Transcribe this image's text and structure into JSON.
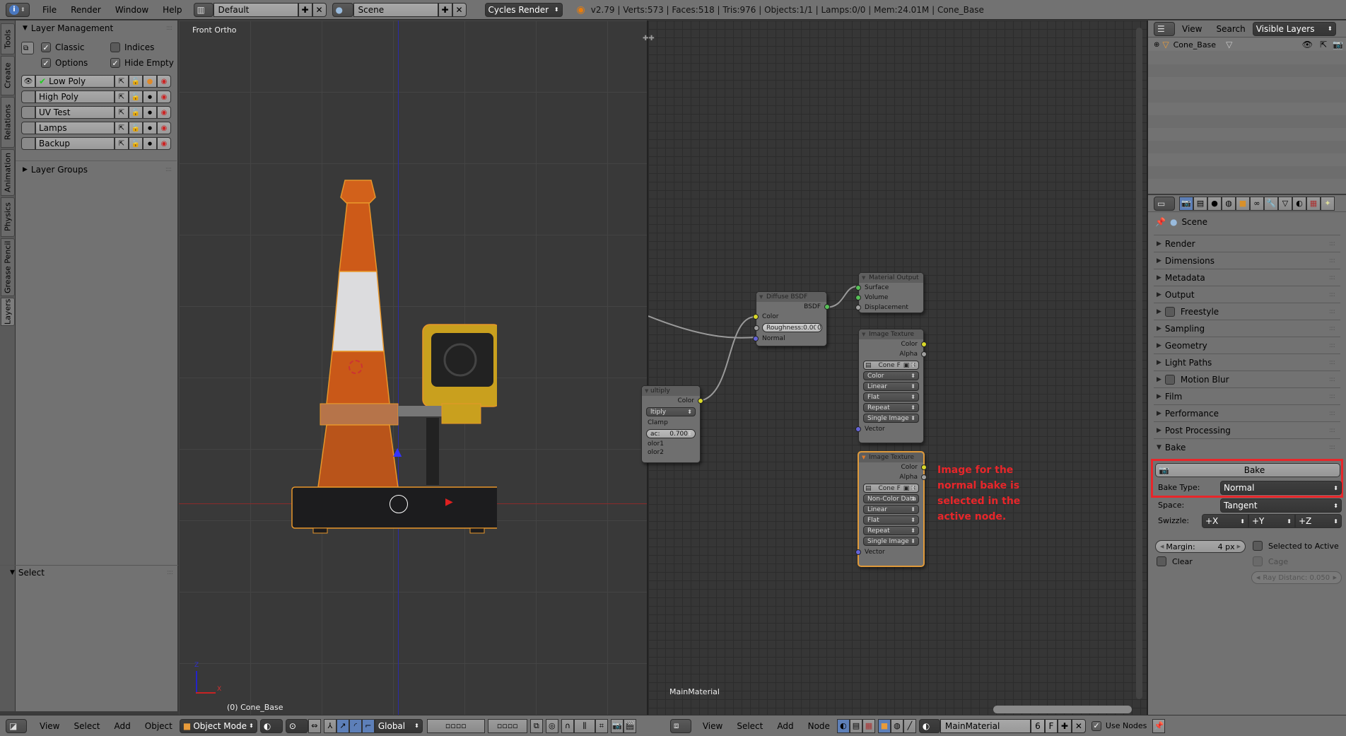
{
  "topbar": {
    "info_icon": "info-icon",
    "menus": [
      "File",
      "Render",
      "Window",
      "Help"
    ],
    "screen_layout": "Default",
    "scene": "Scene",
    "render_engine": "Cycles Render",
    "stats": "v2.79 | Verts:573 | Faces:518 | Tris:976 | Objects:1/1 | Lamps:0/0 | Mem:24.01M | Cone_Base"
  },
  "left_tabs": [
    "Tools",
    "Create",
    "Relations",
    "Animation",
    "Physics",
    "Grease Pencil",
    "Layers"
  ],
  "layer_management": {
    "title": "Layer Management",
    "options": {
      "classic": {
        "label": "Classic",
        "checked": true
      },
      "indices": {
        "label": "Indices",
        "checked": false
      },
      "options": {
        "label": "Options",
        "checked": true
      },
      "hide_empty": {
        "label": "Hide Empty",
        "checked": true
      }
    },
    "layers": [
      {
        "name": "Low Poly",
        "visible": true,
        "active": true
      },
      {
        "name": "High Poly",
        "visible": false,
        "active": false
      },
      {
        "name": "UV Test",
        "visible": false,
        "active": false
      },
      {
        "name": "Lamps",
        "visible": false,
        "active": false
      },
      {
        "name": "Backup",
        "visible": false,
        "active": false
      }
    ],
    "layer_groups": "Layer Groups"
  },
  "operator_panel": {
    "title": "Select"
  },
  "viewport": {
    "view_label": "Front Ortho",
    "object_label": "(0) Cone_Base",
    "axis_z": "Z",
    "axis_x": "X"
  },
  "viewport_header": {
    "menus": [
      "View",
      "Select",
      "Add",
      "Object"
    ],
    "mode": "Object Mode",
    "orientation": "Global"
  },
  "node_editor": {
    "material_label": "MainMaterial",
    "annotation": "Image for the normal bake is selected in the active node.",
    "annotation_color": "#e8262a",
    "nodes": {
      "diffuse": {
        "title": "Diffuse BSDF",
        "output": "BSDF",
        "inputs": [
          "Color",
          "Normal"
        ],
        "roughness": "Roughness:0.000"
      },
      "material_output": {
        "title": "Material Output",
        "inputs": [
          "Surface",
          "Volume",
          "Displacement"
        ]
      },
      "mix": {
        "title": "ultiply",
        "output": "Color",
        "blend": "ltiply",
        "clamp": "Clamp",
        "fac": "ac:",
        "fac_value": "0.700",
        "inputs": [
          "olor1",
          "olor2"
        ]
      },
      "image1": {
        "title": "Image Texture",
        "outputs": [
          "Color",
          "Alpha"
        ],
        "image": "Cone",
        "fake": "F",
        "color_space": "Color",
        "interpolation": "Linear",
        "projection": "Flat",
        "extension": "Repeat",
        "source": "Single Image",
        "input": "Vector"
      },
      "image2": {
        "title": "Image Texture",
        "outputs": [
          "Color",
          "Alpha"
        ],
        "image": "Cone",
        "fake": "F",
        "color_space": "Non-Color Data",
        "interpolation": "Linear",
        "projection": "Flat",
        "extension": "Repeat",
        "source": "Single Image",
        "input": "Vector"
      }
    }
  },
  "node_header": {
    "menus": [
      "View",
      "Select",
      "Add",
      "Node"
    ],
    "material": "MainMaterial",
    "users": "6",
    "fake": "F",
    "use_nodes": "Use Nodes"
  },
  "outliner": {
    "menus": [
      "View",
      "Search"
    ],
    "filter": "Visible Layers",
    "items": [
      {
        "name": "Cone_Base"
      }
    ]
  },
  "properties": {
    "context": "Scene",
    "sections": [
      "Render",
      "Dimensions",
      "Metadata",
      "Output",
      "Freestyle",
      "Sampling",
      "Geometry",
      "Light Paths",
      "Motion Blur",
      "Film",
      "Performance",
      "Post Processing",
      "Bake"
    ],
    "bake": {
      "button": "Bake",
      "bake_type_label": "Bake Type:",
      "bake_type": "Normal",
      "space_label": "Space:",
      "space": "Tangent",
      "swizzle_label": "Swizzle:",
      "swizzle": [
        "+X",
        "+Y",
        "+Z"
      ],
      "margin_label": "Margin:",
      "margin_value": "4 px",
      "clear": "Clear",
      "selected_to_active": "Selected to Active",
      "cage": "Cage",
      "ray_distance": "Ray Distanc: 0.050"
    },
    "highlight_color": "#e8262a"
  }
}
